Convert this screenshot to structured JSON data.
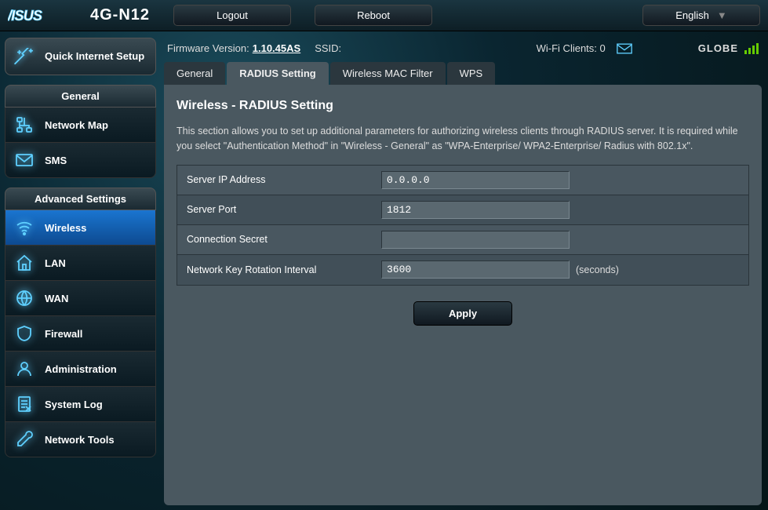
{
  "header": {
    "brand_text": "ASUS",
    "model": "4G-N12",
    "logout": "Logout",
    "reboot": "Reboot",
    "language": "English"
  },
  "sidebar": {
    "qis": "Quick Internet Setup",
    "general_hdr": "General",
    "general_items": [
      {
        "label": "Network Map"
      },
      {
        "label": "SMS"
      }
    ],
    "advanced_hdr": "Advanced Settings",
    "advanced_items": [
      {
        "label": "Wireless",
        "active": true
      },
      {
        "label": "LAN"
      },
      {
        "label": "WAN"
      },
      {
        "label": "Firewall"
      },
      {
        "label": "Administration"
      },
      {
        "label": "System Log"
      },
      {
        "label": "Network Tools"
      }
    ]
  },
  "status": {
    "fw_label": "Firmware Version:",
    "fw_value": "1.10.45AS",
    "ssid_label": "SSID:",
    "ssid_value": "",
    "wifi_clients_label": "Wi-Fi Clients:",
    "wifi_clients_value": "0",
    "carrier": "GLOBE"
  },
  "tabs": [
    {
      "label": "General"
    },
    {
      "label": "RADIUS Setting",
      "active": true
    },
    {
      "label": "Wireless MAC Filter"
    },
    {
      "label": "WPS"
    }
  ],
  "panel": {
    "title": "Wireless - RADIUS Setting",
    "desc": "This section allows you to set up additional parameters for authorizing wireless clients through RADIUS server. It is required while you select \"Authentication Method\" in \"Wireless - General\" as \"WPA-Enterprise/ WPA2-Enterprise/ Radius with 802.1x\".",
    "fields": {
      "server_ip": {
        "label": "Server IP Address",
        "value": "0.0.0.0"
      },
      "server_port": {
        "label": "Server Port",
        "value": "1812"
      },
      "secret": {
        "label": "Connection Secret",
        "value": ""
      },
      "rotation": {
        "label": "Network Key Rotation Interval",
        "value": "3600",
        "suffix": "(seconds)"
      }
    },
    "apply": "Apply"
  }
}
